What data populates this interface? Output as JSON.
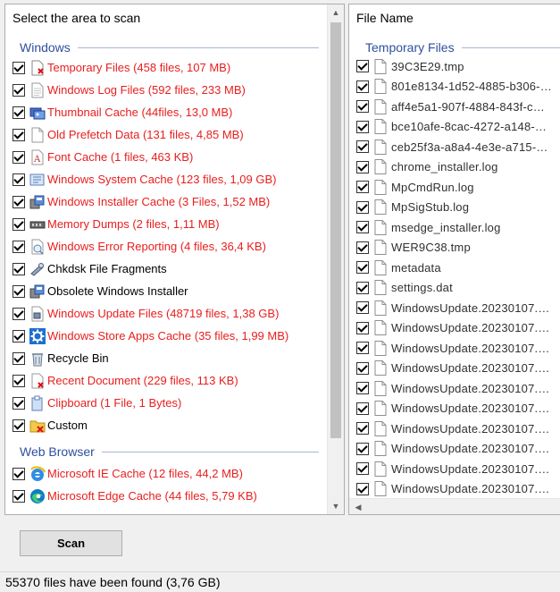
{
  "left_pane": {
    "header": "Select the area to scan",
    "groups": [
      {
        "title": "Windows",
        "items": [
          {
            "label": "Temporary Files (458 files, 107 MB)",
            "icon": "temp-files-icon"
          },
          {
            "label": "Windows Log Files (592 files, 233 MB)",
            "icon": "log-file-icon"
          },
          {
            "label": "Thumbnail Cache (44files, 13,0 MB)",
            "icon": "thumbnail-icon"
          },
          {
            "label": "Old Prefetch Data (131 files, 4,85 MB)",
            "icon": "blank-page-icon"
          },
          {
            "label": "Font Cache (1 files, 463 KB)",
            "icon": "font-icon"
          },
          {
            "label": "Windows System Cache (123 files, 1,09 GB)",
            "icon": "system-cache-icon"
          },
          {
            "label": "Windows Installer Cache (3 Files, 1,52 MB)",
            "icon": "installer-icon"
          },
          {
            "label": "Memory Dumps (2 files, 1,11 MB)",
            "icon": "memory-icon"
          },
          {
            "label": "Windows Error Reporting (4 files, 36,4 KB)",
            "icon": "error-report-icon"
          },
          {
            "label": "Chkdsk File Fragments",
            "icon": "chkdsk-icon"
          },
          {
            "label": "Obsolete Windows Installer",
            "icon": "installer-icon"
          },
          {
            "label": "Windows Update Files (48719 files, 1,38 GB)",
            "icon": "windows-update-icon"
          },
          {
            "label": "Windows Store Apps Cache (35 files, 1,99 MB)",
            "icon": "gear-icon"
          },
          {
            "label": "Recycle Bin",
            "icon": "recycle-bin-icon"
          },
          {
            "label": "Recent Document (229 files, 113 KB)",
            "icon": "recent-doc-icon"
          },
          {
            "label": "Clipboard (1 File, 1 Bytes)",
            "icon": "clipboard-icon"
          },
          {
            "label": "Custom",
            "icon": "custom-folder-icon"
          }
        ]
      },
      {
        "title": "Web Browser",
        "items": [
          {
            "label": "Microsoft IE Cache (12 files, 44,2 MB)",
            "icon": "ie-icon"
          },
          {
            "label": "Microsoft Edge Cache (44 files, 5,79 KB)",
            "icon": "edge-icon"
          }
        ]
      }
    ]
  },
  "right_pane": {
    "header": "File Name",
    "group": "Temporary Files",
    "files": [
      "39C3E29.tmp",
      "801e8134-1d52-4885-b306-…",
      "aff4e5a1-907f-4884-843f-c…",
      "bce10afe-8cac-4272-a148-…",
      "ceb25f3a-a8a4-4e3e-a715-…",
      "chrome_installer.log",
      "MpCmdRun.log",
      "MpSigStub.log",
      "msedge_installer.log",
      "WER9C38.tmp",
      "metadata",
      "settings.dat",
      "WindowsUpdate.20230107.…",
      "WindowsUpdate.20230107.…",
      "WindowsUpdate.20230107.…",
      "WindowsUpdate.20230107.…",
      "WindowsUpdate.20230107.…",
      "WindowsUpdate.20230107.…",
      "WindowsUpdate.20230107.…",
      "WindowsUpdate.20230107.…",
      "WindowsUpdate.20230107.…",
      "WindowsUpdate.20230107.…"
    ]
  },
  "scan_button": "Scan",
  "status": "55370  files have been found (3,76 GB)",
  "colors": {
    "found_red": "#e81e1e",
    "group_blue": "#2e4f9e"
  }
}
